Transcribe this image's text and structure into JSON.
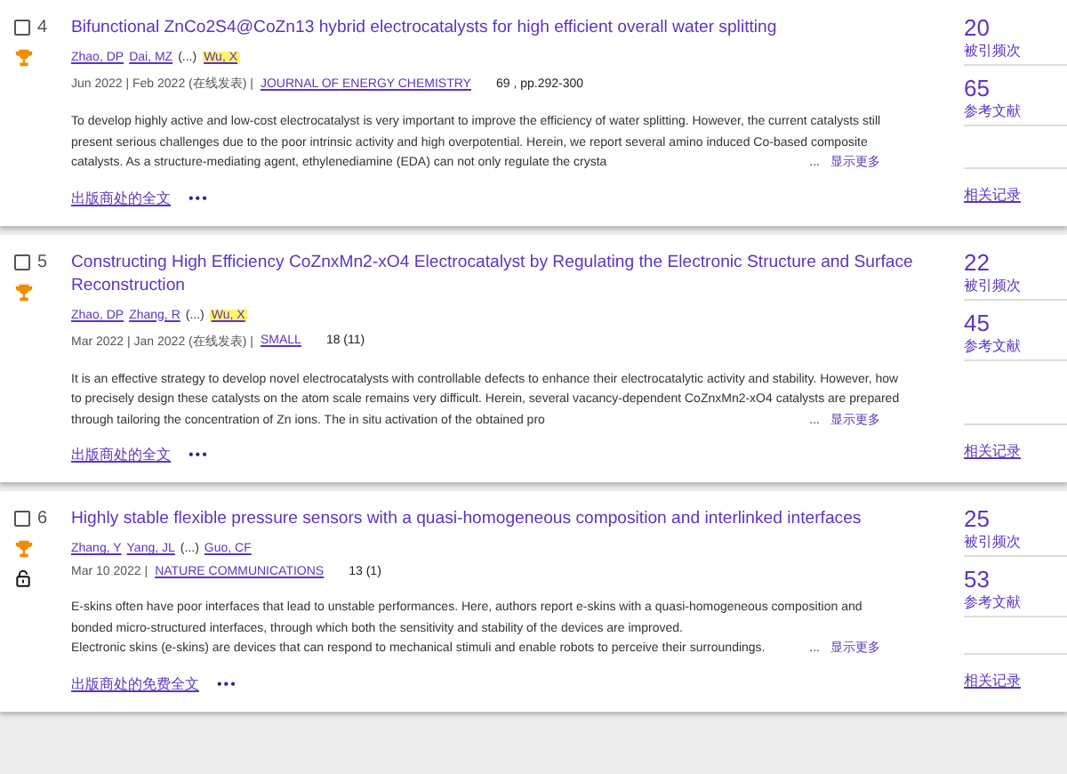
{
  "records": [
    {
      "number": "4",
      "checked": false,
      "highly_cited": true,
      "open_access": false,
      "title": "Bifunctional ZnCo2S4@CoZn13 hybrid electrocatalysts for high efficient overall water splitting",
      "authors": [
        {
          "name": "Zhao, DP",
          "highlighted": false
        },
        {
          "name": "Dai, MZ",
          "highlighted": false
        },
        {
          "name": "Wu, X",
          "highlighted": true
        }
      ],
      "authors_gap": "(...)",
      "dates": "Jun 2022 | Feb 2022 (在线发表) |",
      "journal": "JOURNAL OF ENERGY CHEMISTRY",
      "volume": "69 , pp.292-300",
      "abstract": [
        "To develop highly active and low-cost electrocatalyst is very important to improve the efficiency of water splitting. However, the current catalysts still",
        "present serious challenges due to the poor intrinsic activity and high overpotential. Herein, we report several amino induced Co-based composite",
        "catalysts. As a structure-mediating agent, ethylenediamine (EDA) can not only regulate the crysta"
      ],
      "ellipsis": "...",
      "show_more": "显示更多",
      "full_text": "出版商处的全文",
      "more": "•••",
      "citations": "20",
      "citations_label": "被引频次",
      "references": "65",
      "references_label": "参考文献",
      "related": "相关记录"
    },
    {
      "number": "5",
      "checked": false,
      "highly_cited": true,
      "open_access": false,
      "title": "Constructing High Efficiency CoZnxMn2-xO4 Electrocatalyst by Regulating the Electronic Structure and Surface Reconstruction",
      "authors": [
        {
          "name": "Zhao, DP",
          "highlighted": false
        },
        {
          "name": "Zhang, R",
          "highlighted": false
        },
        {
          "name": "Wu, X",
          "highlighted": true
        }
      ],
      "authors_gap": "(...)",
      "dates": "Mar 2022 | Jan 2022 (在线发表) |",
      "journal": "SMALL",
      "volume": "18 (11)",
      "abstract": [
        "It is an effective strategy to develop novel electrocatalysts with controllable defects to enhance their electrocatalytic activity and stability. However, how",
        "to precisely design these catalysts on the atom scale remains very difficult. Herein, several vacancy-dependent CoZnxMn2-xO4 catalysts are prepared",
        "through tailoring the concentration of Zn ions. The in situ activation of the obtained pro"
      ],
      "ellipsis": "...",
      "show_more": "显示更多",
      "full_text": "出版商处的全文",
      "more": "•••",
      "citations": "22",
      "citations_label": "被引频次",
      "references": "45",
      "references_label": "参考文献",
      "related": "相关记录"
    },
    {
      "number": "6",
      "checked": false,
      "highly_cited": true,
      "open_access": true,
      "title": "Highly stable flexible pressure sensors with a quasi-homogeneous composition and interlinked interfaces",
      "authors": [
        {
          "name": "Zhang, Y",
          "highlighted": false
        },
        {
          "name": "Yang, JL",
          "highlighted": false
        },
        {
          "name": "Guo, CF",
          "highlighted": false
        }
      ],
      "authors_gap": "(...)",
      "dates": "Mar 10 2022 |",
      "journal": "NATURE COMMUNICATIONS",
      "volume": "13 (1)",
      "abstract": [
        "E-skins often have poor interfaces that lead to unstable performances. Here, authors report e-skins with a quasi-homogeneous composition and",
        "bonded micro-structured interfaces, through which both the sensitivity and stability of the devices are improved.",
        "Electronic skins (e-skins) are devices that can respond to mechanical stimuli and enable robots to perceive their surroundings."
      ],
      "ellipsis": "...",
      "show_more": "显示更多",
      "full_text": "出版商处的免费全文",
      "more": "•••",
      "citations": "25",
      "citations_label": "被引频次",
      "references": "53",
      "references_label": "参考文献",
      "related": "相关记录"
    }
  ]
}
